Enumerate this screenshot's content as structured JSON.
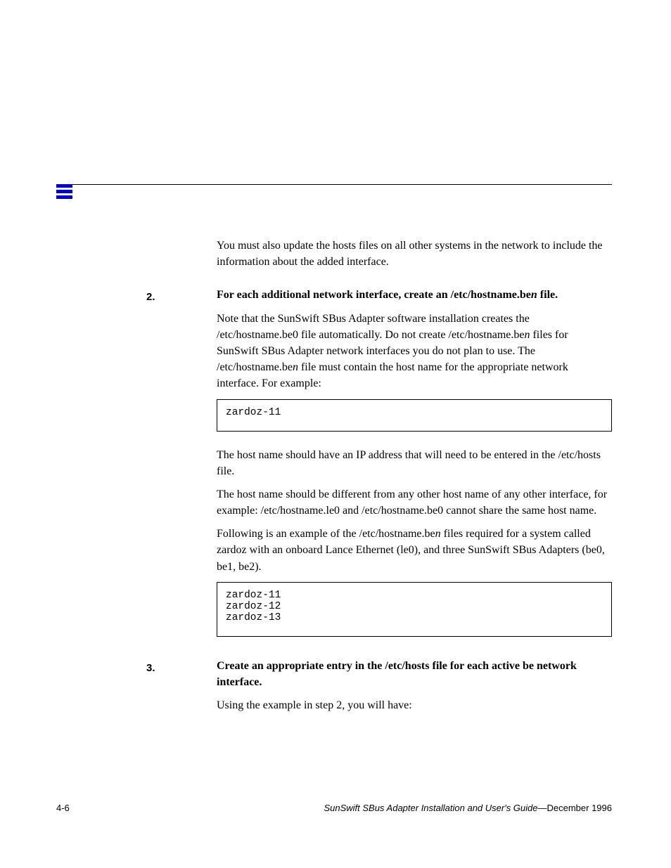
{
  "header": {
    "icon": "hamburger-icon"
  },
  "content": {
    "p1": "You must also update the hosts files on all other systems in the network to include the information about the added interface.",
    "step2_marker": "2.",
    "step2_text": "For each additional network interface, create an /etc/hostname.be",
    "step2_tail": " file.",
    "step2_note": "Note that the SunSwift SBus Adapter software installation creates the\n/etc/hostname.be0 file automatically.",
    "step2_cont": " Do not create /etc/hostname.be",
    "step2_cont_post": "files for SunSwift SBus Adapter network interfaces you do not plan to use. The /etc/hostname.be",
    "step2_cont_post2": " file must contain the host name for the appropriate network interface. For example:",
    "n_var": "n",
    "code1": "zardoz-11",
    "p3a": "The host name should have an IP address that will need to be entered in the /etc/hosts file.",
    "p3b": "The host name should be different from any other host name of any other interface, for example: /etc/hostname.le0 and /etc/hostname.be0 cannot share the same host name.",
    "p3c": "Following is an example of the /etc/hostname.be",
    "p3c_post": " files required for a system called zardoz with an onboard Lance Ethernet (le0), and three SunSwift SBus Adapters (be0, be1, be2).",
    "code2": "zardoz-11\nzardoz-12\nzardoz-13",
    "step3_marker": "3.",
    "step3_text": "Create an appropriate entry in the /etc/hosts file for each active be network interface.",
    "p4": "Using the example in step 2, you will have:"
  },
  "footer": {
    "page_num": "4-6",
    "doc_title": "SunSwift SBus Adapter Installation and User's Guide",
    "date": "—December 1996"
  }
}
